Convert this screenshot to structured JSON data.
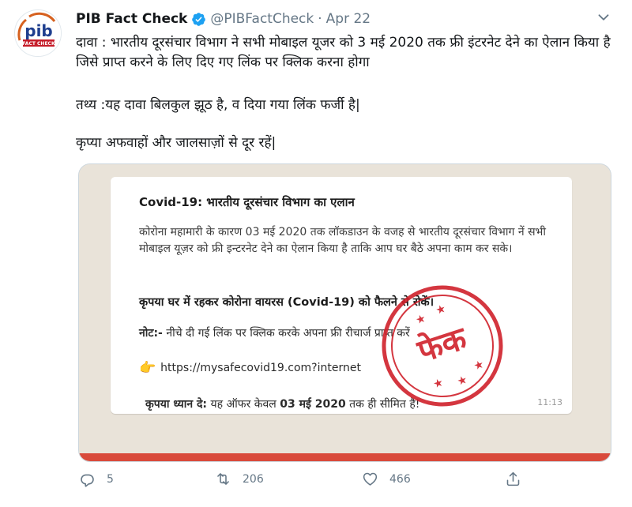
{
  "tweet": {
    "author_name": "PIB Fact Check",
    "handle": "@PIBFactCheck",
    "separator": "·",
    "date": "Apr 22",
    "avatar_text_top": "pib",
    "avatar_text_band": "FACT CHECK",
    "text_line1": "दावा : भारतीय दूरसंचार विभाग ने सभी मोबाइल यूजर को 3 मई 2020 तक फ्री इंटरनेट देने का ऐलान किया है जिसे प्राप्त करने के लिए दिए गए लिंक पर क्लिक करना होगा",
    "text_line2": "तथ्य :यह दावा बिलकुल झूठ है, व दिया गया लिंक फर्जी है|",
    "text_line3": "कृप्या अफवाहों और जालसाज़ों से दूर रहें|"
  },
  "media": {
    "title": "Covid-19: भारतीय दूरसंचार विभाग का एलान",
    "paragraph": "कोरोना महामारी के कारण 03 मई 2020 तक लॉकडाउन के वजह से भारतीय दूरसंचार विभाग नें सभी मोबाइल यूज़र को फ्री इन्टरनेट देने का ऐलान किया है ताकि आप घर बैठे अपना काम कर सके।",
    "bold_line": "कृपया घर में रहकर कोरोना वायरस (Covid-19) को फैलने से रोकें।",
    "note_label": "नोट:-",
    "note_text": " नीचे दी गई लिंक पर क्लिक करके अपना फ्री रीचार्ज प्राप्त करें",
    "link_url": "https://mysafecovid19.com?internet",
    "attention_label": "कृपया ध्यान दे:",
    "attention_text": " यह ऑफर केवल ",
    "attention_date": "03 मई 2020",
    "attention_end": " तक ही सीमित है!",
    "time": "11:13",
    "stamp_text": "फेक"
  },
  "actions": {
    "reply_count": "5",
    "retweet_count": "206",
    "like_count": "466"
  },
  "colors": {
    "verified": "#1da1f2",
    "stamp": "#d0212b",
    "muted": "#657786"
  }
}
